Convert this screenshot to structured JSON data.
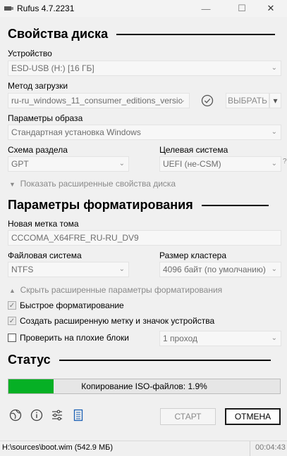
{
  "window": {
    "title": "Rufus 4.7.2231",
    "minimize": "—",
    "maximize": "☐",
    "close": "✕"
  },
  "disk": {
    "heading": "Свойства диска",
    "device_label": "Устройство",
    "device_value": "ESD-USB (H:) [16 ГБ]",
    "boot_label": "Метод загрузки",
    "boot_value": "ru-ru_windows_11_consumer_editions_versic",
    "select_button": "ВЫБРАТЬ",
    "image_label": "Параметры образа",
    "image_value": "Стандартная установка Windows",
    "scheme_label": "Схема раздела",
    "scheme_value": "GPT",
    "target_label": "Целевая система",
    "target_value": "UEFI (не-CSM)",
    "help_mark": "?",
    "advanced_toggle": "Показать расширенные свойства диска"
  },
  "format": {
    "heading": "Параметры форматирования",
    "volume_label": "Новая метка тома",
    "volume_value": "CCCOMA_X64FRE_RU-RU_DV9",
    "fs_label": "Файловая система",
    "fs_value": "NTFS",
    "cluster_label": "Размер кластера",
    "cluster_value": "4096 байт (по умолчанию)",
    "advanced_toggle": "Скрыть расширенные параметры форматирования",
    "quick_format": "Быстрое форматирование",
    "extended_label": "Создать расширенную метку и значок устройства",
    "bad_blocks": "Проверить на плохие блоки",
    "passes_value": "1 проход"
  },
  "status": {
    "heading": "Статус",
    "progress_text": "Копирование ISO-файлов: 1.9%",
    "progress_percent": 1.9
  },
  "actions": {
    "start": "СТАРТ",
    "cancel": "ОТМЕНА"
  },
  "statusbar": {
    "left": "H:\\sources\\boot.wim (542.9 МБ)",
    "right": "00:04:43"
  }
}
